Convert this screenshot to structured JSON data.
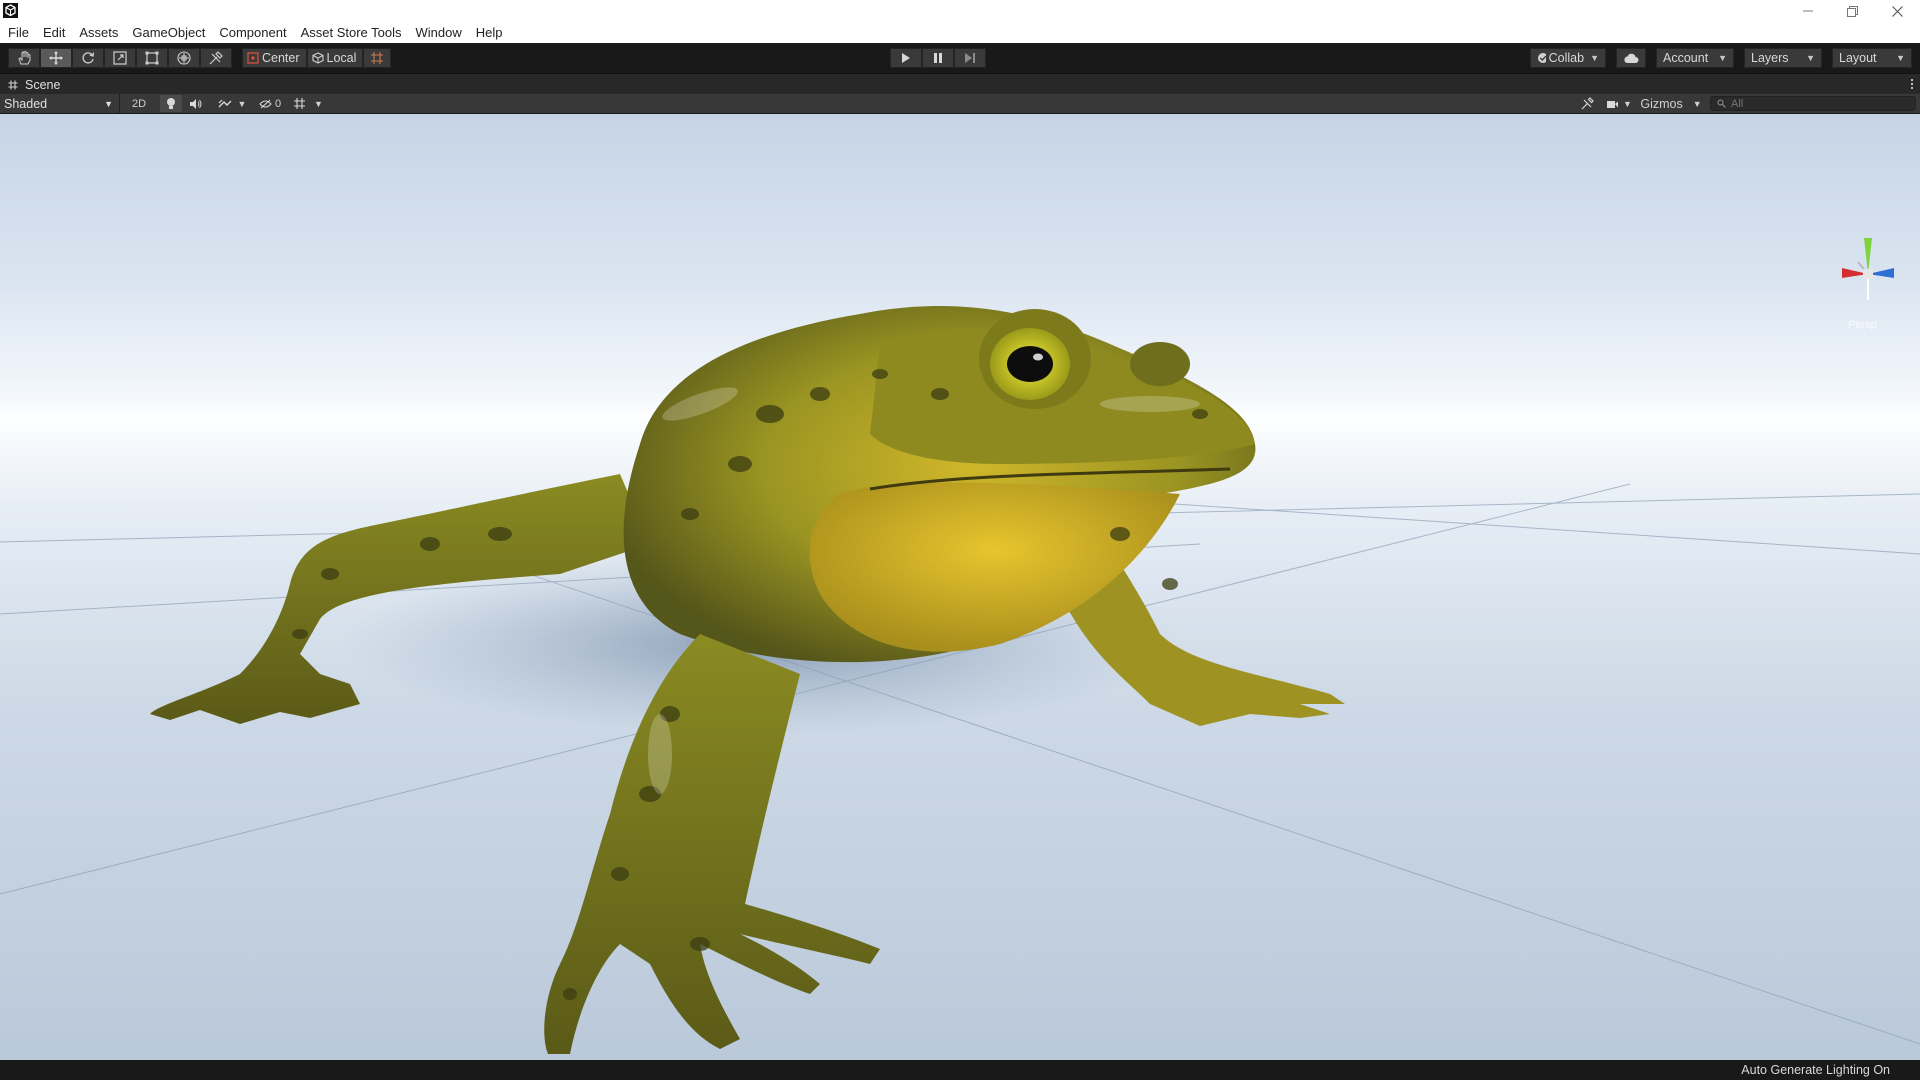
{
  "menu": {
    "items": [
      "File",
      "Edit",
      "Assets",
      "GameObject",
      "Component",
      "Asset Store Tools",
      "Window",
      "Help"
    ]
  },
  "toolbar": {
    "tools": [
      "hand-icon",
      "move-icon",
      "rotate-icon",
      "scale-icon",
      "rect-icon",
      "transform-icon",
      "custom-tool-icon"
    ],
    "active_tool": "move-icon",
    "pivot_label": "Center",
    "space_label": "Local",
    "collab_label": "Collab",
    "account_label": "Account",
    "layers_label": "Layers",
    "layout_label": "Layout"
  },
  "scene_tab": {
    "label": "Scene"
  },
  "scene_toolbar": {
    "draw_mode": "Shaded",
    "toggle_2d": "2D",
    "hidden_count": "0",
    "gizmos_label": "Gizmos",
    "search_placeholder": "All"
  },
  "viewport": {
    "projection_label": "Persp",
    "axis_colors": {
      "x": "#d32f2f",
      "y": "#7fd33f",
      "z": "#2f6fd3"
    }
  },
  "status": {
    "text": "Auto Generate Lighting On"
  },
  "colors": {
    "toolbar_bg": "#191919",
    "button_bg": "#3a3a3a",
    "active_button_bg": "#5a5a5a",
    "scene_toolbar_bg": "#383838"
  }
}
